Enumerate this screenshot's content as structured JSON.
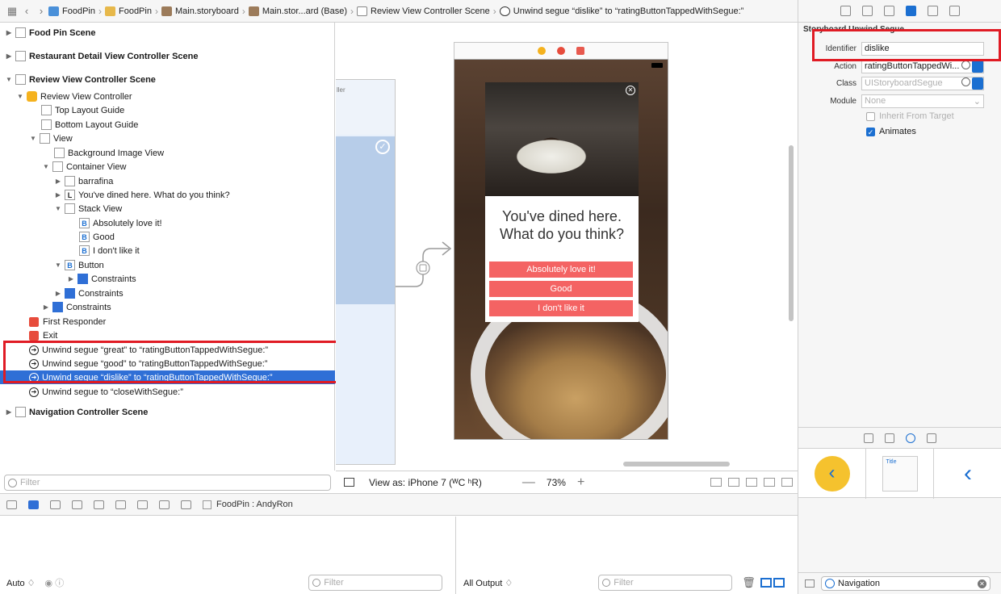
{
  "jumpbar": {
    "crumbs": [
      "FoodPin",
      "FoodPin",
      "Main.storyboard",
      "Main.stor...ard (Base)",
      "Review View Controller Scene",
      "Unwind segue “dislike” to “ratingButtonTappedWithSegue:”"
    ]
  },
  "outline": {
    "rows": [
      {
        "label": "Food Pin Scene"
      },
      {
        "label": "Restaurant Detail View Controller Scene"
      },
      {
        "label": "Review View Controller Scene"
      },
      {
        "label": "Review View Controller"
      },
      {
        "label": "Top Layout Guide"
      },
      {
        "label": "Bottom Layout Guide"
      },
      {
        "label": "View"
      },
      {
        "label": "Background Image View"
      },
      {
        "label": "Container View"
      },
      {
        "label": "barrafina"
      },
      {
        "label": "You've dined here. What do you think?",
        "badge": "L"
      },
      {
        "label": "Stack View"
      },
      {
        "label": "Absolutely love it!",
        "badge": "B"
      },
      {
        "label": "Good",
        "badge": "B"
      },
      {
        "label": "I don't like it",
        "badge": "B"
      },
      {
        "label": "Button",
        "badge": "B"
      },
      {
        "label": "Constraints"
      },
      {
        "label": "Constraints"
      },
      {
        "label": "Constraints"
      },
      {
        "label": "First Responder"
      },
      {
        "label": "Exit"
      },
      {
        "label": "Unwind segue “great” to “ratingButtonTappedWithSegue:”"
      },
      {
        "label": "Unwind segue “good” to “ratingButtonTappedWithSegue:”"
      },
      {
        "label": "Unwind segue “dislike” to “ratingButtonTappedWithSegue:”"
      },
      {
        "label": "Unwind segue to “closeWithSegue:”"
      },
      {
        "label": "Navigation Controller Scene"
      }
    ],
    "filter_placeholder": "Filter"
  },
  "canvas": {
    "question": "You've dined here. What do you think?",
    "buttons": [
      "Absolutely love it!",
      "Good",
      "I don't like it"
    ],
    "prev_label": "ller",
    "view_as": "View as: iPhone 7 (ᵂC ʰR)",
    "zoom": "73%"
  },
  "debug": {
    "process": "FoodPin : AndyRon",
    "auto": "Auto ♢",
    "filter": "Filter",
    "output": "All Output ♢",
    "filter2": "Filter"
  },
  "inspector": {
    "section": "Storyboard Unwind Segue",
    "identifier_label": "Identifier",
    "identifier_value": "dislike",
    "action_label": "Action",
    "action_value": "ratingButtonTappedWi...",
    "class_label": "Class",
    "class_value": "UIStoryboardSegue",
    "module_label": "Module",
    "module_value": "None",
    "inherit_label": "Inherit From Target",
    "animates_label": "Animates",
    "library_title_sample": "Title",
    "library_filter": "Navigation"
  },
  "colors": {
    "selection": "#2f6fd6",
    "highlight_box": "#e01b24",
    "button_red": "#f46363",
    "accent": "#1b6fd1"
  }
}
